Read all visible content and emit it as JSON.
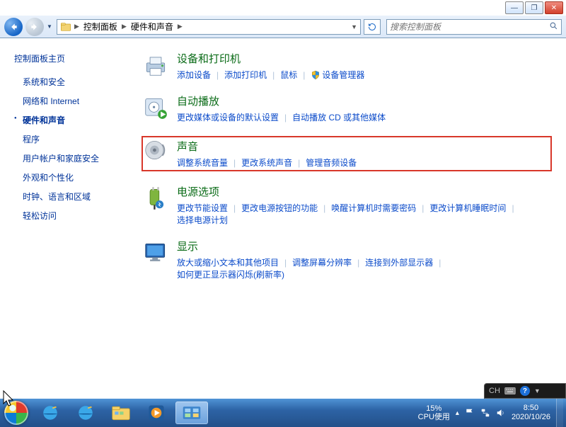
{
  "window_buttons": {
    "minimize": "—",
    "maximize": "❐",
    "close": "✕"
  },
  "toolbar": {
    "breadcrumb": [
      "控制面板",
      "硬件和声音"
    ],
    "search_placeholder": "搜索控制面板"
  },
  "sidebar": {
    "home": "控制面板主页",
    "items": [
      {
        "label": "系统和安全",
        "active": false
      },
      {
        "label": "网络和 Internet",
        "active": false
      },
      {
        "label": "硬件和声音",
        "active": true
      },
      {
        "label": "程序",
        "active": false
      },
      {
        "label": "用户帐户和家庭安全",
        "active": false
      },
      {
        "label": "外观和个性化",
        "active": false
      },
      {
        "label": "时钟、语言和区域",
        "active": false
      },
      {
        "label": "轻松访问",
        "active": false
      }
    ]
  },
  "sections": [
    {
      "icon": "printer",
      "title": "设备和打印机",
      "highlight": false,
      "links": [
        {
          "label": "添加设备"
        },
        {
          "label": "添加打印机"
        },
        {
          "label": "鼠标"
        },
        {
          "label": "设备管理器",
          "shield": true
        }
      ]
    },
    {
      "icon": "autoplay",
      "title": "自动播放",
      "highlight": false,
      "links": [
        {
          "label": "更改媒体或设备的默认设置"
        },
        {
          "label": "自动播放 CD 或其他媒体"
        }
      ]
    },
    {
      "icon": "sound",
      "title": "声音",
      "highlight": true,
      "links": [
        {
          "label": "调整系统音量"
        },
        {
          "label": "更改系统声音"
        },
        {
          "label": "管理音频设备"
        }
      ]
    },
    {
      "icon": "power",
      "title": "电源选项",
      "highlight": false,
      "links": [
        {
          "label": "更改节能设置"
        },
        {
          "label": "更改电源按钮的功能"
        },
        {
          "label": "唤醒计算机时需要密码"
        },
        {
          "label": "更改计算机睡眠时间"
        },
        {
          "label": "选择电源计划"
        }
      ]
    },
    {
      "icon": "display",
      "title": "显示",
      "highlight": false,
      "links": [
        {
          "label": "放大或缩小文本和其他项目"
        },
        {
          "label": "调整屏幕分辨率"
        },
        {
          "label": "连接到外部显示器"
        },
        {
          "label": "如何更正显示器闪烁(刷新率)"
        }
      ]
    }
  ],
  "lang_bar": {
    "label": "CH"
  },
  "systray": {
    "cpu_pct": "15%",
    "cpu_label": "CPU使用",
    "time": "8:50",
    "date": "2020/10/26"
  }
}
